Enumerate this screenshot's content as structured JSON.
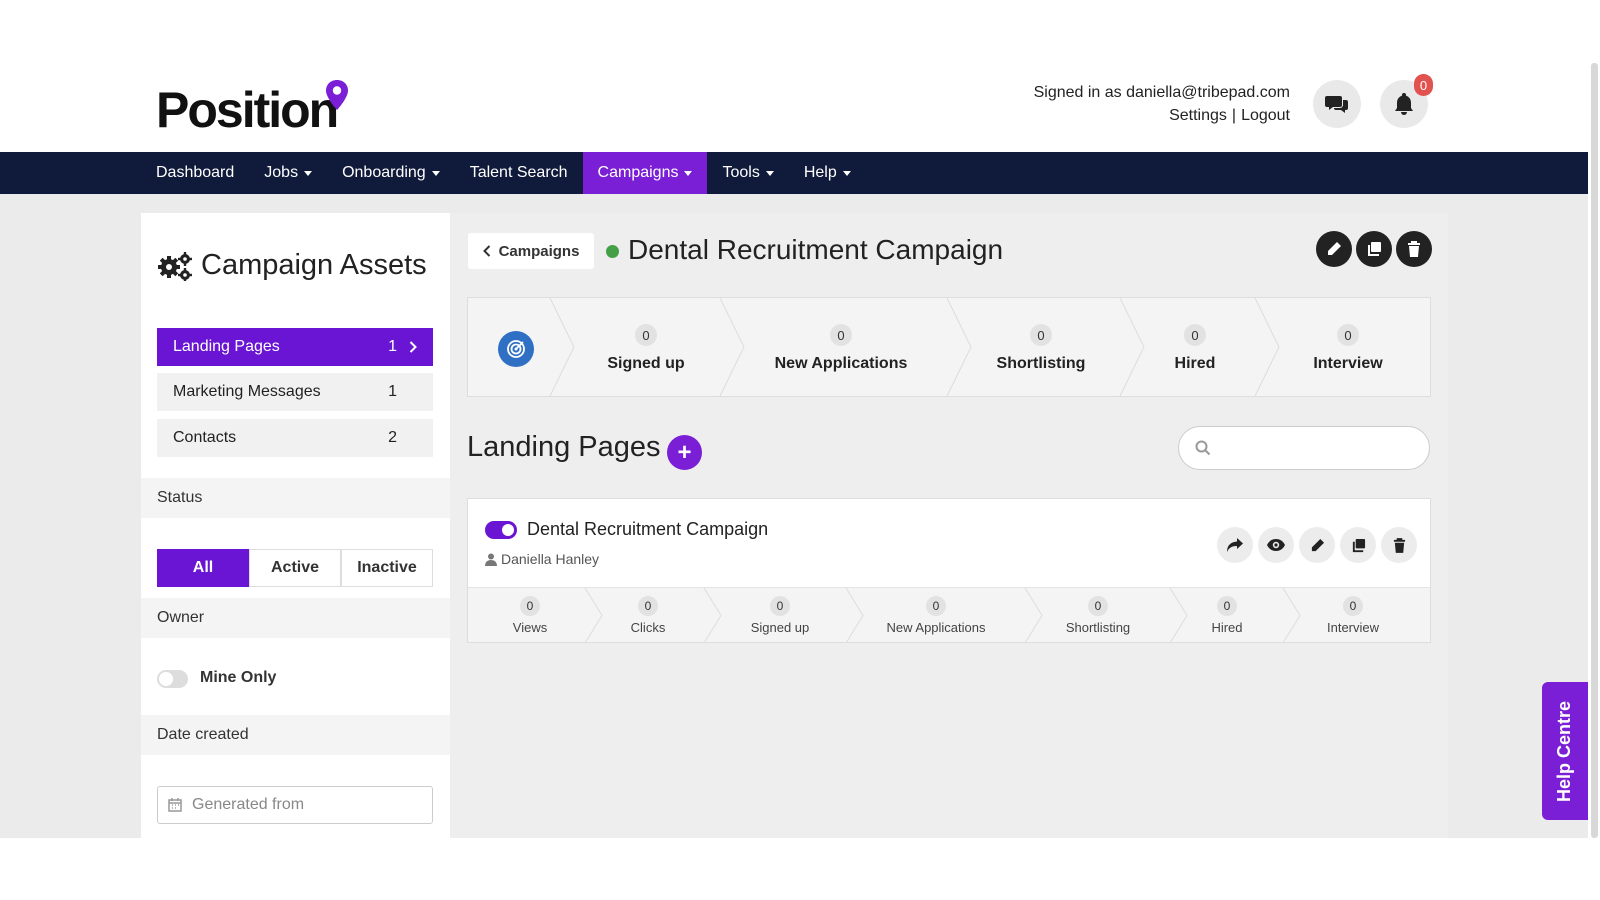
{
  "app": {
    "logo": "Position",
    "accent": "#7b1fd6",
    "nav_bg": "#101a3a"
  },
  "header": {
    "signed_in": "Signed in as daniella@tribepad.com",
    "settings": "Settings",
    "separator": "|",
    "logout": "Logout",
    "notification_count": "0"
  },
  "nav": [
    {
      "label": "Dashboard"
    },
    {
      "label": "Jobs"
    },
    {
      "label": "Onboarding"
    },
    {
      "label": "Talent Search"
    },
    {
      "label": "Campaigns"
    },
    {
      "label": "Tools"
    },
    {
      "label": "Help"
    }
  ],
  "sidebar": {
    "title": "Campaign Assets",
    "items": [
      {
        "label": "Landing Pages",
        "count": "1"
      },
      {
        "label": "Marketing Messages",
        "count": "1"
      },
      {
        "label": "Contacts",
        "count": "2"
      }
    ],
    "status_label": "Status",
    "status_options": [
      "All",
      "Active",
      "Inactive"
    ],
    "owner_label": "Owner",
    "mine_only": "Mine Only",
    "date_label": "Date created",
    "date_placeholder": "Generated from"
  },
  "campaign": {
    "back": "Campaigns",
    "title": "Dental Recruitment Campaign",
    "stats": [
      {
        "value": "0",
        "label": "Signed up"
      },
      {
        "value": "0",
        "label": "New Applications"
      },
      {
        "value": "0",
        "label": "Shortlisting"
      },
      {
        "value": "0",
        "label": "Hired"
      },
      {
        "value": "0",
        "label": "Interview"
      }
    ]
  },
  "landing_pages": {
    "title": "Landing Pages",
    "add": "+",
    "search_placeholder": "",
    "cards": [
      {
        "title": "Dental Recruitment Campaign",
        "owner": "Daniella Hanley",
        "stats": [
          {
            "value": "0",
            "label": "Views"
          },
          {
            "value": "0",
            "label": "Clicks"
          },
          {
            "value": "0",
            "label": "Signed up"
          },
          {
            "value": "0",
            "label": "New Applications"
          },
          {
            "value": "0",
            "label": "Shortlisting"
          },
          {
            "value": "0",
            "label": "Hired"
          },
          {
            "value": "0",
            "label": "Interview"
          }
        ]
      }
    ]
  },
  "help_centre": "Help Centre"
}
